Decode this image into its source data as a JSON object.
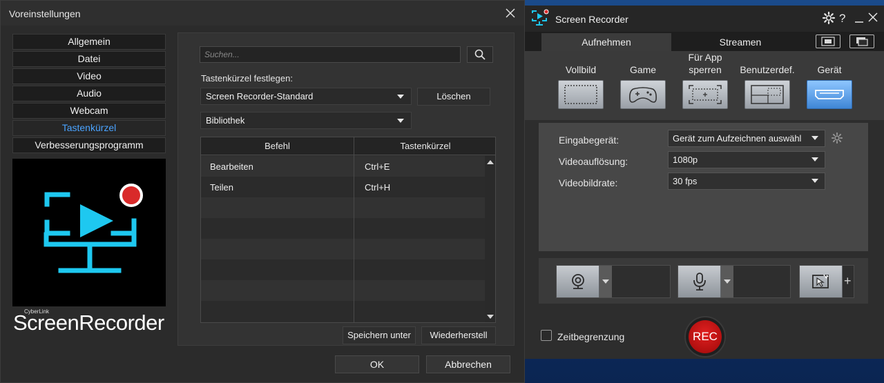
{
  "prefs": {
    "title": "Voreinstellungen",
    "nav": [
      "Allgemein",
      "Datei",
      "Video",
      "Audio",
      "Webcam",
      "Tastenkürzel",
      "Verbesserungsprogramm"
    ],
    "active_nav": "Tastenkürzel",
    "brand_small": "CyberLink",
    "brand_big": "ScreenRecorder",
    "search_placeholder": "Suchen...",
    "shortcut_label": "Tastenkürzel festlegen:",
    "preset_value": "Screen Recorder-Standard",
    "delete_label": "Löschen",
    "category_value": "Bibliothek",
    "table": {
      "headers": [
        "Befehl",
        "Tastenkürzel"
      ],
      "rows": [
        {
          "command": "Bearbeiten",
          "shortcut": "Ctrl+E"
        },
        {
          "command": "Teilen",
          "shortcut": "Ctrl+H"
        },
        {
          "command": "",
          "shortcut": ""
        },
        {
          "command": "",
          "shortcut": ""
        },
        {
          "command": "",
          "shortcut": ""
        },
        {
          "command": "",
          "shortcut": ""
        },
        {
          "command": "",
          "shortcut": ""
        },
        {
          "command": "",
          "shortcut": ""
        }
      ]
    },
    "save_as_label": "Speichern unter",
    "restore_label": "Wiederherstell",
    "ok_label": "OK",
    "cancel_label": "Abbrechen"
  },
  "recorder": {
    "title": "Screen Recorder",
    "tabs": [
      "Aufnehmen",
      "Streamen"
    ],
    "active_tab": "Aufnehmen",
    "modes": [
      {
        "label": "Vollbild"
      },
      {
        "label": "Game"
      },
      {
        "label": "Für App sperren"
      },
      {
        "label": "Benutzerdef."
      },
      {
        "label": "Gerät"
      }
    ],
    "active_mode": "Gerät",
    "settings": {
      "input_label": "Eingabegerät:",
      "input_value": "Gerät zum Aufzeichnen auswähl",
      "resolution_label": "Videoauflösung:",
      "resolution_value": "1080p",
      "framerate_label": "Videobildrate:",
      "framerate_value": "30 fps"
    },
    "time_limit_label": "Zeitbegrenzung",
    "rec_label": "REC"
  },
  "colors": {
    "accent_blue": "#4aa3ff",
    "logo_cyan": "#1ec8f0",
    "rec_red": "#c01515",
    "active_mode_blue": "#3f86d6"
  }
}
